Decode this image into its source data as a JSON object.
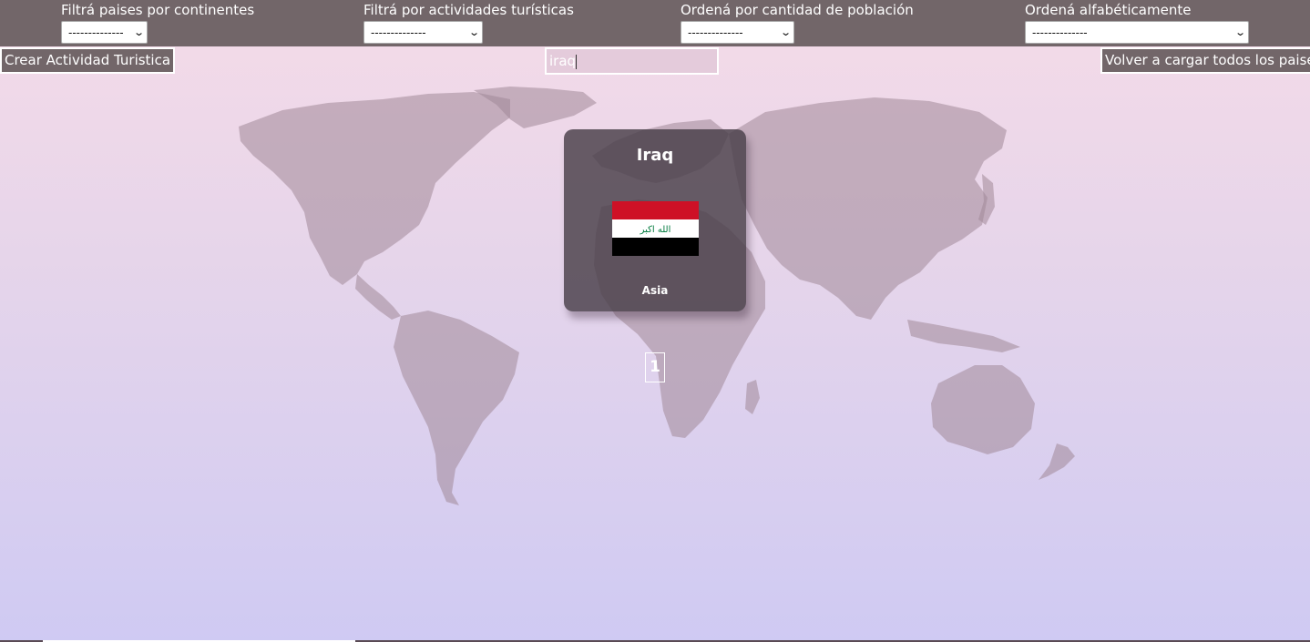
{
  "filters": [
    {
      "label": "Filtrá paises por continentes",
      "selected": "--------------"
    },
    {
      "label": "Filtrá por actividades turísticas",
      "selected": "--------------"
    },
    {
      "label": "Ordená por cantidad de población",
      "selected": "--------------"
    },
    {
      "label": "Ordená alfabéticamente",
      "selected": "--------------"
    }
  ],
  "actions": {
    "create_activity": "Crear Actividad Turistica",
    "reload_all": "Volver a cargar todos los paises"
  },
  "search": {
    "value": "iraq"
  },
  "results": [
    {
      "name": "Iraq",
      "continent": "Asia",
      "flag_emblem": "الله اكبر"
    }
  ],
  "pagination": {
    "pages": [
      "1"
    ]
  },
  "colors": {
    "topbar": "#726669",
    "card": "#4e444f",
    "flag_red": "#ce1126",
    "flag_green": "#007a3d"
  }
}
